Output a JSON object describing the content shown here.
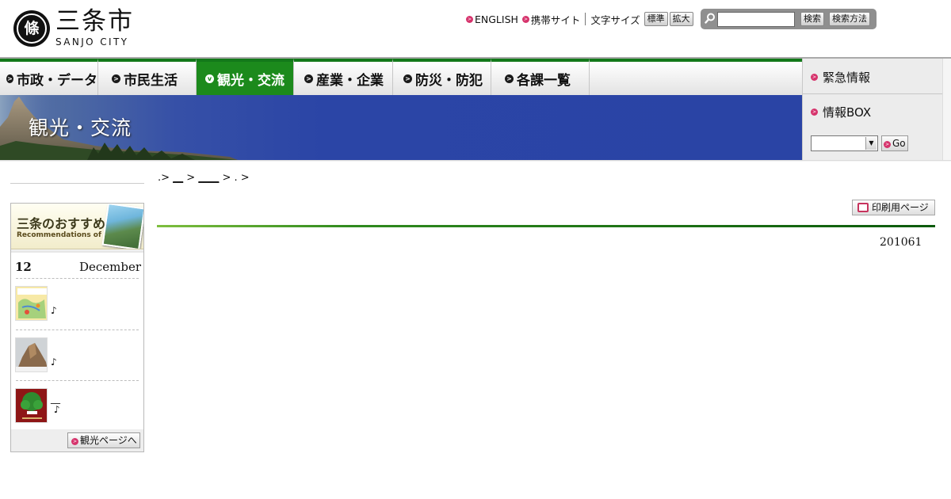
{
  "header": {
    "logo_mark": "條",
    "logo_jp": "三条市",
    "logo_en": "SANJO CITY",
    "utility": {
      "english": "ENGLISH",
      "mobile": "携帯サイト",
      "font_size_label": "文字サイズ",
      "standard": "標準",
      "enlarge": "拡大"
    },
    "search": {
      "value": "",
      "placeholder": "",
      "button": "検索",
      "help": "検索方法"
    }
  },
  "nav": {
    "items": [
      {
        "label": "市政・データ",
        "active": false
      },
      {
        "label": "市民生活",
        "active": false
      },
      {
        "label": "観光・交流",
        "active": true
      },
      {
        "label": "産業・企業",
        "active": false
      },
      {
        "label": "防災・防犯",
        "active": false
      },
      {
        "label": "各課一覧",
        "active": false
      }
    ]
  },
  "banner": {
    "title": "観光・交流"
  },
  "side": {
    "emergency": "緊急情報",
    "infobox": "情報BOX",
    "select_value": "",
    "go": "Go"
  },
  "breadcrumb": {
    "sep1": ".> ",
    "link1": "__",
    "sep2": " > ",
    "link2": "____",
    "sep3": " > . >"
  },
  "recommend": {
    "title": "三条のおすすめ",
    "subtitle": "Recommendations of Sanjo",
    "day": "12",
    "month": "December",
    "items": [
      {
        "text": "♪"
      },
      {
        "text": "♪"
      },
      {
        "text": "__\n ♪"
      }
    ],
    "tourism_button": "観光ページへ"
  },
  "main": {
    "print_button": "印刷用ページ",
    "date": "201061"
  },
  "colors": {
    "nav_green": "#13791a",
    "nav_active": "#1c8a1c",
    "banner_blue": "#2a44a5",
    "accent_pink": "#d6336c"
  }
}
